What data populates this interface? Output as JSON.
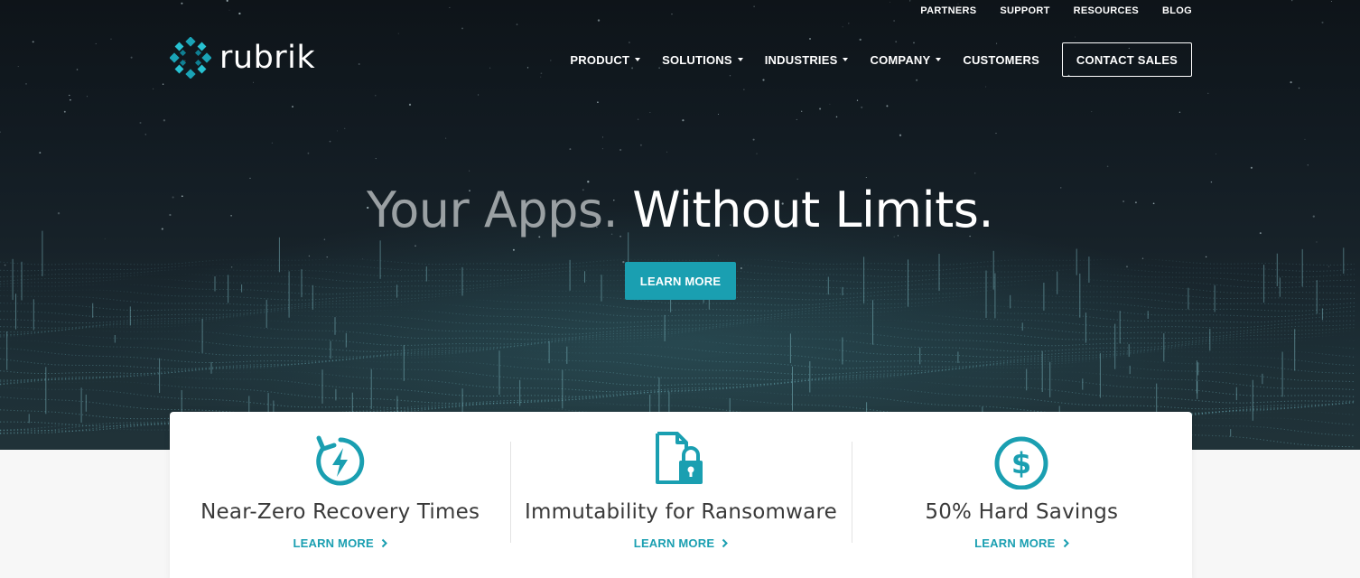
{
  "utility_nav": [
    "PARTNERS",
    "SUPPORT",
    "RESOURCES",
    "BLOG"
  ],
  "brand": {
    "name": "rubrik",
    "accent": "#1a9fb1"
  },
  "main_nav": {
    "items": [
      {
        "label": "PRODUCT",
        "dropdown": true
      },
      {
        "label": "SOLUTIONS",
        "dropdown": true
      },
      {
        "label": "INDUSTRIES",
        "dropdown": true
      },
      {
        "label": "COMPANY",
        "dropdown": true
      },
      {
        "label": "CUSTOMERS",
        "dropdown": false
      }
    ],
    "cta": "CONTACT SALES"
  },
  "hero": {
    "headline_part1": "Your Apps.",
    "headline_part2": "Without Limits.",
    "button": "LEARN MORE"
  },
  "features": [
    {
      "icon": "recovery-bolt-icon",
      "title": "Near-Zero Recovery Times",
      "link": "LEARN MORE"
    },
    {
      "icon": "locked-document-icon",
      "title": "Immutability for Ransomware",
      "link": "LEARN MORE"
    },
    {
      "icon": "dollar-circle-icon",
      "title": "50% Hard Savings",
      "link": "LEARN MORE"
    }
  ]
}
